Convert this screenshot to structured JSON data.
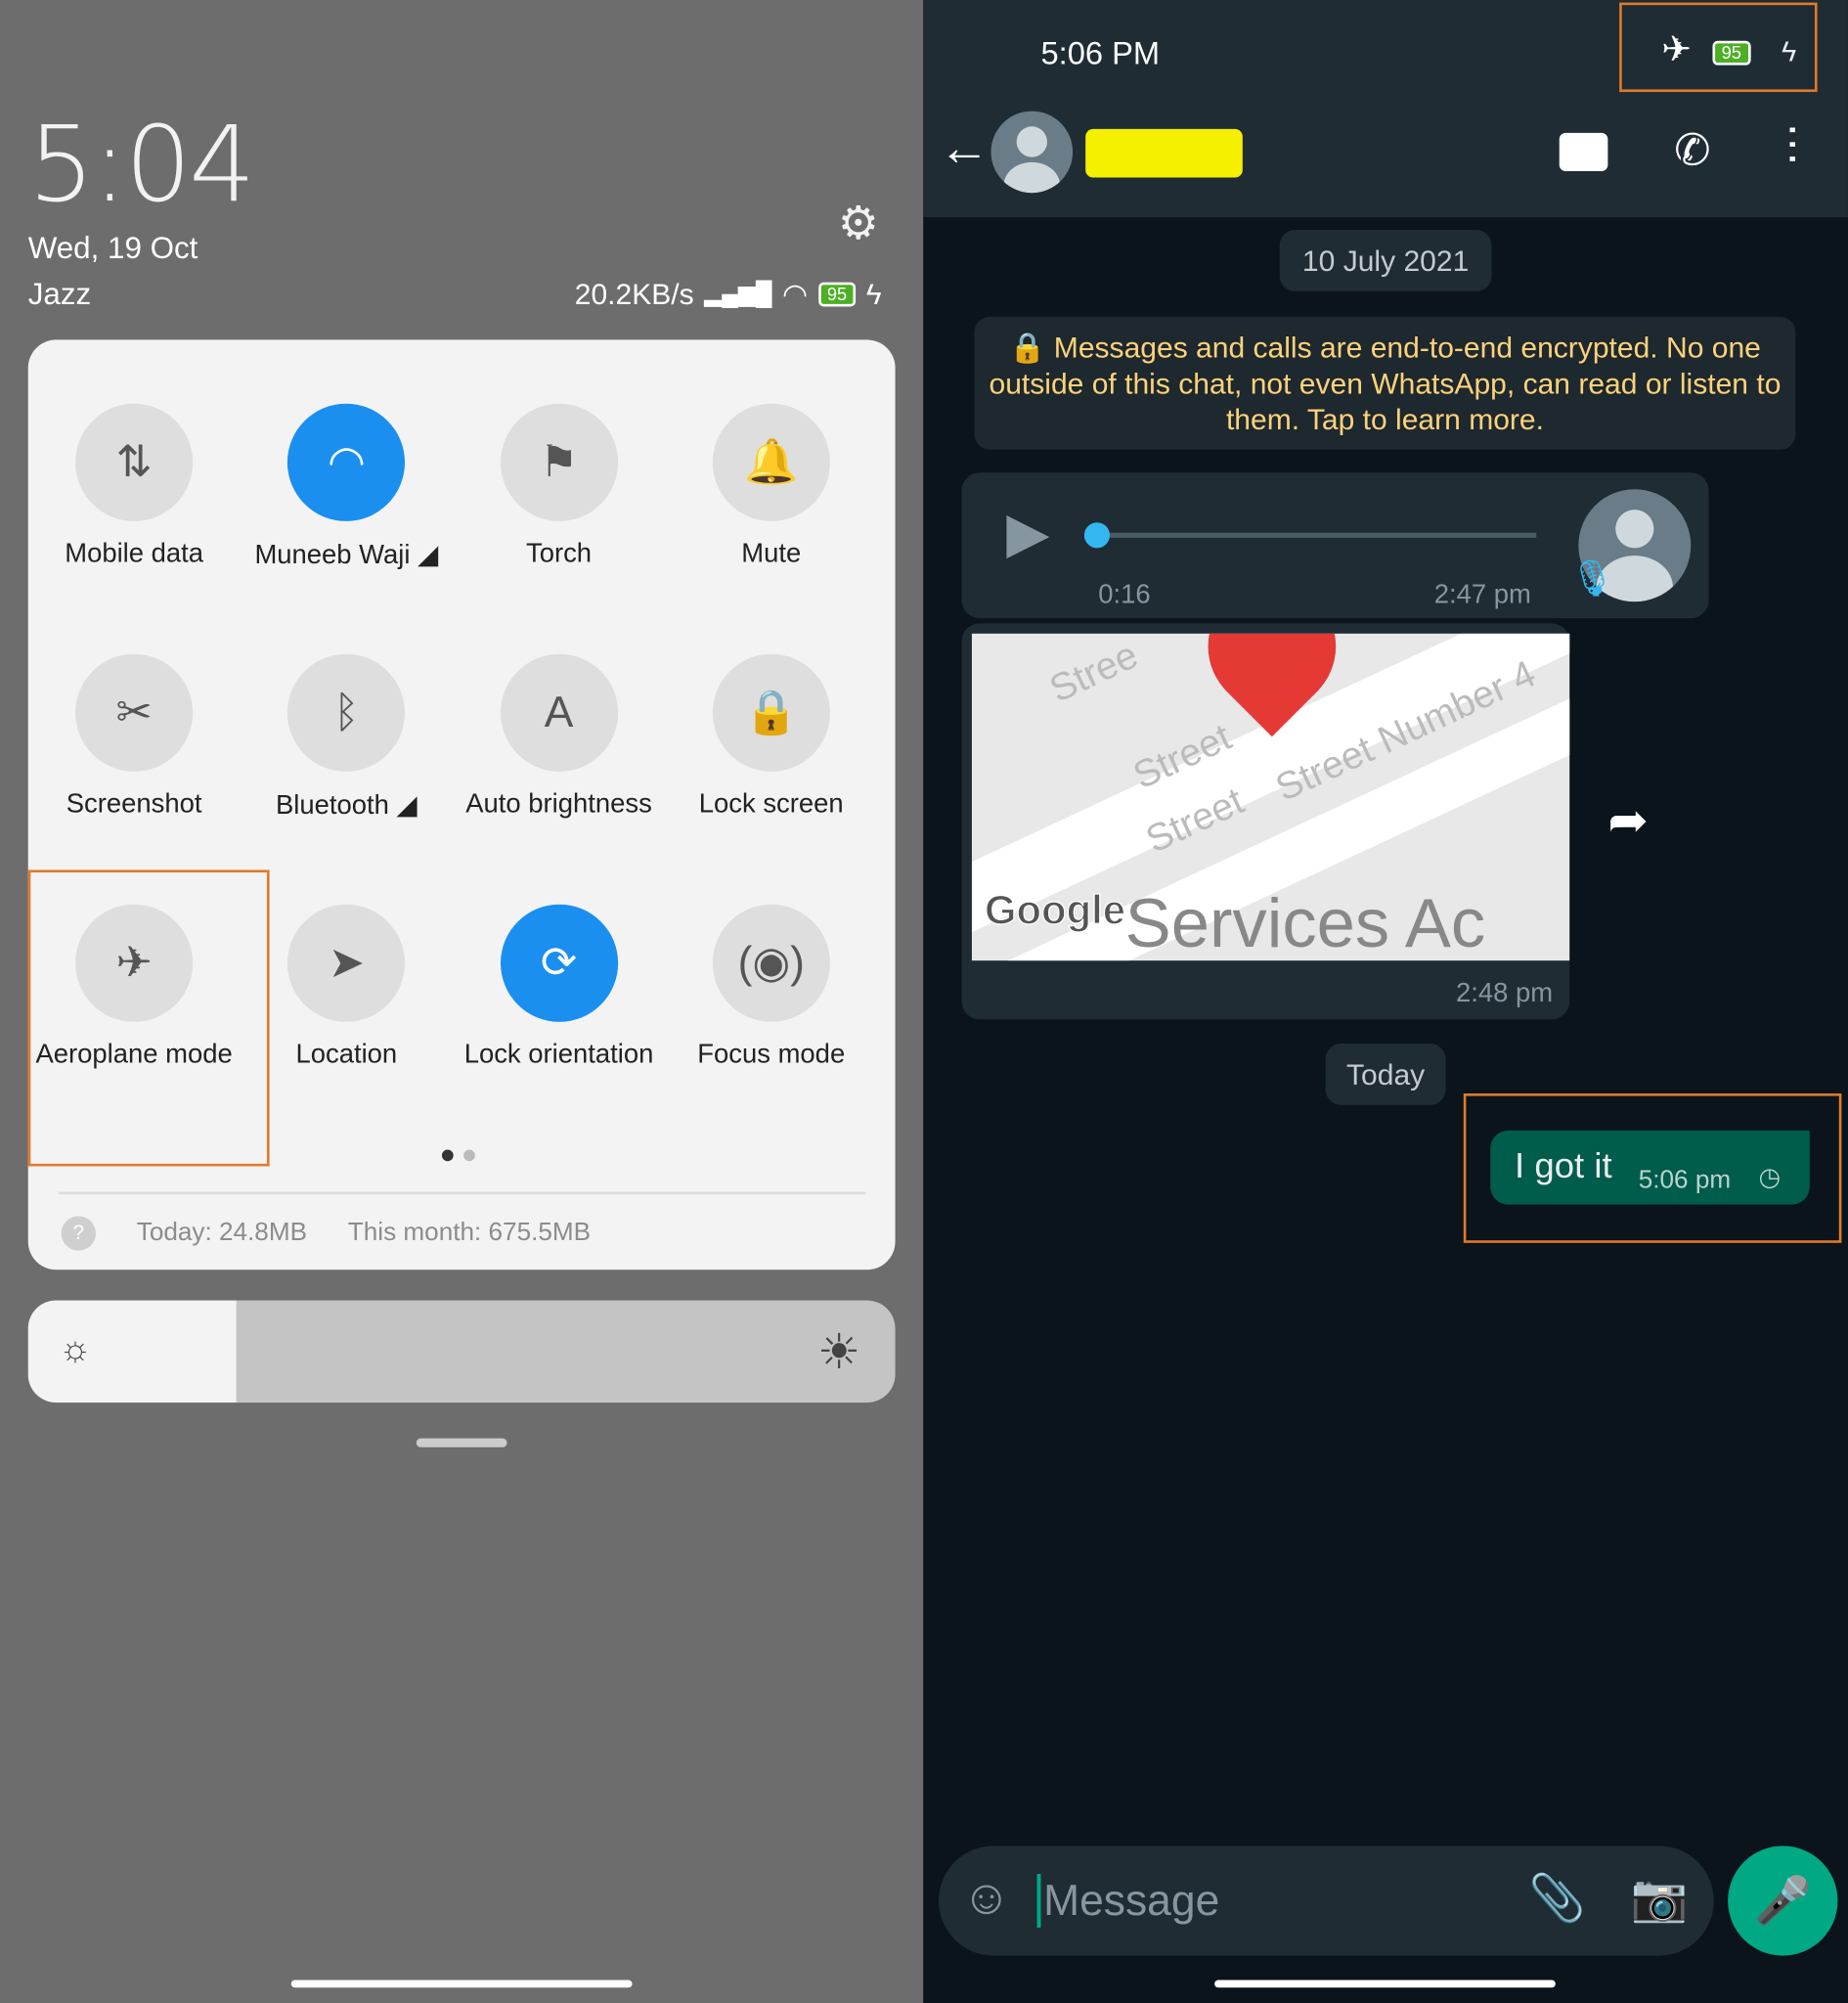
{
  "left": {
    "clock": "5:04",
    "date": "Wed, 19 Oct",
    "carrier": "Jazz",
    "speed": "20.2KB/s",
    "battery": "95",
    "tiles": [
      {
        "label": "Mobile data",
        "icon": "data-arrows-icon",
        "on": false
      },
      {
        "label": "Muneeb Waji ◢",
        "icon": "wifi-icon",
        "on": true
      },
      {
        "label": "Torch",
        "icon": "torch-icon",
        "on": false
      },
      {
        "label": "Mute",
        "icon": "bell-icon",
        "on": false
      },
      {
        "label": "Screenshot",
        "icon": "scissors-icon",
        "on": false
      },
      {
        "label": "Bluetooth ◢",
        "icon": "bluetooth-icon",
        "on": false
      },
      {
        "label": "Auto brightness",
        "icon": "auto-brightness-icon",
        "on": false
      },
      {
        "label": "Lock screen",
        "icon": "lock-icon",
        "on": false
      },
      {
        "label": "Aeroplane mode",
        "icon": "airplane-icon",
        "on": false
      },
      {
        "label": "Location",
        "icon": "location-icon",
        "on": false
      },
      {
        "label": "Lock orientation",
        "icon": "rotation-lock-icon",
        "on": true
      },
      {
        "label": "Focus mode",
        "icon": "focus-icon",
        "on": false
      }
    ],
    "page_index": 1,
    "page_count": 2,
    "usage_today": "Today: 24.8MB",
    "usage_month": "This month: 675.5MB",
    "brightness_percent": 24
  },
  "right": {
    "time": "5:06 PM",
    "battery": "95",
    "date_chip": "10 July 2021",
    "encryption": "Messages and calls are end-to-end encrypted. No one outside of this chat, not even WhatsApp, can read or listen to them. Tap to learn more.",
    "voice": {
      "duration": "0:16",
      "time": "2:47 pm",
      "progress": 0
    },
    "map": {
      "brand": "Google",
      "caption": "Services Ac",
      "streets": [
        "Stree",
        "Street",
        "Street",
        "Street Number 4"
      ],
      "time": "2:48 pm"
    },
    "today_chip": "Today",
    "outgoing": {
      "text": "I got it",
      "time": "5:06 pm"
    },
    "input_placeholder": "Message"
  },
  "colors": {
    "accent_blue": "#1a8ff0",
    "whatsapp_green": "#00a884",
    "outgoing_bubble": "#005c4b",
    "highlight": "#e07a2a"
  }
}
